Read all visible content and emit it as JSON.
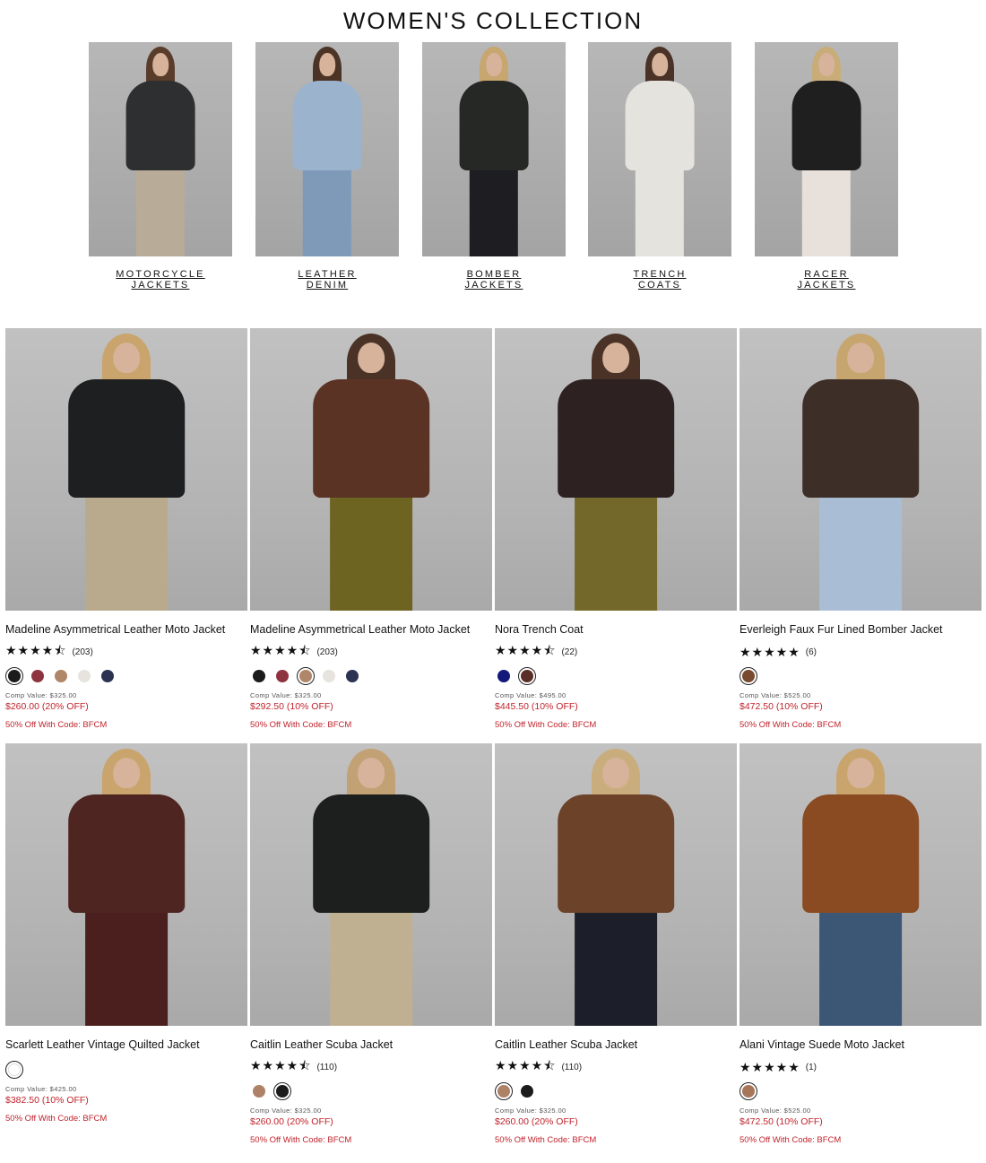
{
  "page": {
    "title": "WOMEN'S COLLECTION"
  },
  "categories": [
    {
      "line1": "MOTORCYCLE",
      "line2": "JACKETS",
      "jacket": "#2e2f30",
      "hair": "#5a3c2b",
      "lower": "#b8ab97"
    },
    {
      "line1": "LEATHER",
      "line2": "DENIM",
      "jacket": "#9bb3cc",
      "hair": "#4b3326",
      "lower": "#7e9ab8"
    },
    {
      "line1": "BOMBER",
      "line2": "JACKETS",
      "jacket": "#262826",
      "hair": "#c7a66f",
      "lower": "#1d1d22"
    },
    {
      "line1": "TRENCH",
      "line2": "COATS",
      "jacket": "#e4e3de",
      "hair": "#4a3226",
      "lower": "#e4e3de"
    },
    {
      "line1": "RACER",
      "line2": "JACKETS",
      "jacket": "#1f1f1f",
      "hair": "#c9ad78",
      "lower": "#e8e1db"
    }
  ],
  "products": [
    {
      "name": "Madeline Asymmetrical Leather Moto Jacket",
      "stars": "★★★★⯪",
      "count": "(203)",
      "swatches": [
        {
          "color": "#1b1b1b",
          "selected": true
        },
        {
          "color": "#8d3440",
          "selected": false
        },
        {
          "color": "#b08669",
          "selected": false
        },
        {
          "color": "#e7e3de",
          "selected": false
        },
        {
          "color": "#2c3352",
          "selected": false
        }
      ],
      "comp": "Comp Value: $325.00",
      "price": "$260.00 (20% OFF)",
      "promo": "50% Off With Code: BFCM",
      "jacket": "#1e1f20",
      "hair": "#c9a46c",
      "lower": "#b9aa8e"
    },
    {
      "name": "Madeline Asymmetrical Leather Moto Jacket",
      "stars": "★★★★⯪",
      "count": "(203)",
      "swatches": [
        {
          "color": "#1b1b1b",
          "selected": false
        },
        {
          "color": "#8d3440",
          "selected": false
        },
        {
          "color": "#b08669",
          "selected": true
        },
        {
          "color": "#e7e3de",
          "selected": false
        },
        {
          "color": "#2c3352",
          "selected": false
        }
      ],
      "comp": "Comp Value: $325.00",
      "price": "$292.50 (10% OFF)",
      "promo": "50% Off With Code: BFCM",
      "jacket": "#5a3325",
      "hair": "#4a3226",
      "lower": "#6d6422"
    },
    {
      "name": "Nora Trench Coat",
      "stars": "★★★★⯪",
      "count": "(22)",
      "swatches": [
        {
          "color": "#14187a",
          "selected": false
        },
        {
          "color": "#5b2d28",
          "selected": true
        }
      ],
      "comp": "Comp Value: $495.00",
      "price": "$445.50 (10% OFF)",
      "promo": "50% Off With Code: BFCM",
      "jacket": "#2d2221",
      "hair": "#4a3226",
      "lower": "#73682a"
    },
    {
      "name": "Everleigh Faux Fur Lined Bomber Jacket",
      "stars": "★★★★★",
      "count": "(6)",
      "swatches": [
        {
          "color": "#7a4a2e",
          "selected": true
        }
      ],
      "comp": "Comp Value: $525.00",
      "price": "$472.50 (10% OFF)",
      "promo": "50% Off With Code: BFCM",
      "jacket": "#3e2e28",
      "hair": "#c7a56f",
      "lower": "#a9bdd5"
    },
    {
      "name": "Scarlett Leather Vintage Quilted Jacket",
      "stars": "",
      "count": "",
      "swatches": [
        {
          "color": "#ffffff",
          "selected": true
        }
      ],
      "comp": "Comp Value: $425.00",
      "price": "$382.50 (10% OFF)",
      "promo": "50% Off With Code: BFCM",
      "jacket": "#4e2520",
      "hair": "#c9a46c",
      "lower": "#4a1f1d"
    },
    {
      "name": "Caitlin Leather Scuba Jacket",
      "stars": "★★★★⯪",
      "count": "(110)",
      "swatches": [
        {
          "color": "#ad8267",
          "selected": false
        },
        {
          "color": "#1b1b1b",
          "selected": true
        }
      ],
      "comp": "Comp Value: $325.00",
      "price": "$260.00 (20% OFF)",
      "promo": "50% Off With Code: BFCM",
      "jacket": "#1d1f1e",
      "hair": "#c2a174",
      "lower": "#bfb092"
    },
    {
      "name": "Caitlin Leather Scuba Jacket",
      "stars": "★★★★⯪",
      "count": "(110)",
      "swatches": [
        {
          "color": "#ad8267",
          "selected": true
        },
        {
          "color": "#1b1b1b",
          "selected": false
        }
      ],
      "comp": "Comp Value: $325.00",
      "price": "$260.00 (20% OFF)",
      "promo": "50% Off With Code: BFCM",
      "jacket": "#6c4229",
      "hair": "#c9ad7c",
      "lower": "#1c1f29"
    },
    {
      "name": "Alani Vintage Suede Moto Jacket",
      "stars": "★★★★★",
      "count": "(1)",
      "swatches": [
        {
          "color": "#a77558",
          "selected": true
        }
      ],
      "comp": "Comp Value: $525.00",
      "price": "$472.50 (10% OFF)",
      "promo": "50% Off With Code: BFCM",
      "jacket": "#8a4a22",
      "hair": "#c9a46c",
      "lower": "#3c5675"
    }
  ]
}
